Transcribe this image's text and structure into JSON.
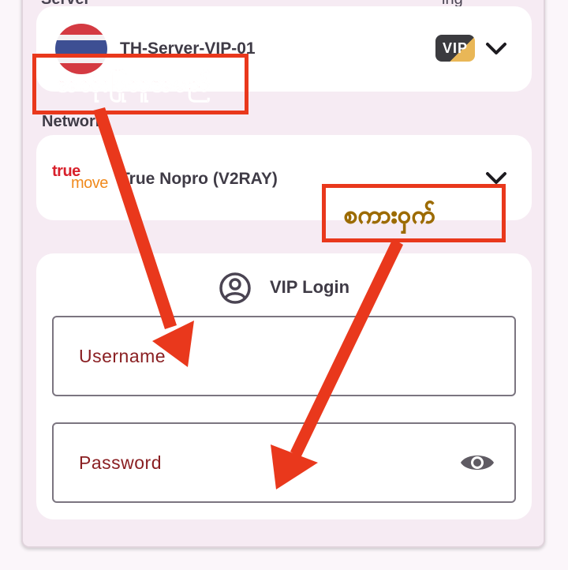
{
  "server": {
    "section_label": "Server",
    "right_label": "ing",
    "name": "TH-Server-VIP-01",
    "badge": "VIP",
    "flag_icon": "thailand-flag-icon"
  },
  "network": {
    "section_label": "Network",
    "name": "True Nopro (V2RAY)",
    "logo": {
      "word1": "true",
      "word2": "move"
    }
  },
  "login": {
    "title": "VIP Login",
    "username_placeholder": "Username",
    "password_placeholder": "Password"
  },
  "annotations": {
    "label_1": "အသုံးပြုသူအမည်",
    "label_2": "စကားဝှက်",
    "color": "#e9381c"
  },
  "colors": {
    "panel": "#f6ebf3",
    "placeholder_text": "#8a1f22",
    "annotation_red": "#e9381c",
    "annotation_yellow": "#f4d23a"
  }
}
